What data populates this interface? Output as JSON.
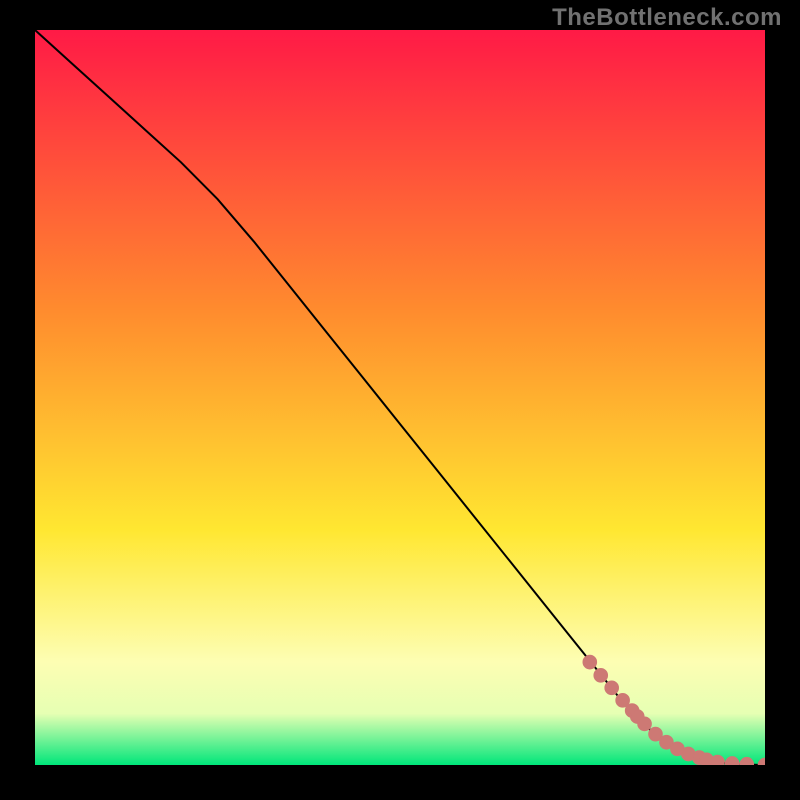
{
  "watermark": "TheBottleneck.com",
  "colors": {
    "curve": "#000000",
    "marker_fill": "#cd7974",
    "marker_stroke": "#cd7974",
    "gradient_top": "#ff1a46",
    "gradient_mid_upper": "#ff8b2e",
    "gradient_mid": "#ffe731",
    "gradient_mid_lower": "#fdfeb3",
    "gradient_band": "#e6ffb3",
    "gradient_bottom": "#00e67a",
    "frame": "#000000"
  },
  "layout": {
    "viewbox_w": 100,
    "viewbox_h": 100,
    "marker_radius": 0.9
  },
  "chart_data": {
    "type": "line",
    "title": "",
    "xlabel": "",
    "ylabel": "",
    "xlim": [
      0,
      100
    ],
    "ylim": [
      0,
      100
    ],
    "grid": false,
    "series": [
      {
        "name": "bottleneck-curve",
        "x": [
          0,
          5,
          10,
          15,
          20,
          25,
          30,
          35,
          40,
          45,
          50,
          55,
          60,
          65,
          70,
          75,
          78,
          80,
          82,
          84,
          86,
          88,
          90,
          92,
          94,
          96,
          98,
          100
        ],
        "y": [
          100,
          95.5,
          91.0,
          86.5,
          82.0,
          77.0,
          71.2,
          65.0,
          58.8,
          52.6,
          46.4,
          40.2,
          34.0,
          27.8,
          21.6,
          15.4,
          11.7,
          9.2,
          6.9,
          5.0,
          3.4,
          2.1,
          1.2,
          0.6,
          0.3,
          0.1,
          0.05,
          0.0
        ]
      }
    ],
    "scatter": {
      "name": "highlighted-points",
      "x": [
        76.0,
        77.5,
        79.0,
        80.5,
        81.8,
        82.5,
        83.5,
        85.0,
        86.5,
        88.0,
        89.5,
        91.0,
        92.0,
        93.5,
        95.5,
        97.5,
        100.0
      ],
      "y": [
        14.0,
        12.2,
        10.5,
        8.8,
        7.4,
        6.6,
        5.6,
        4.2,
        3.1,
        2.2,
        1.5,
        1.0,
        0.7,
        0.4,
        0.2,
        0.1,
        0.0
      ]
    }
  }
}
